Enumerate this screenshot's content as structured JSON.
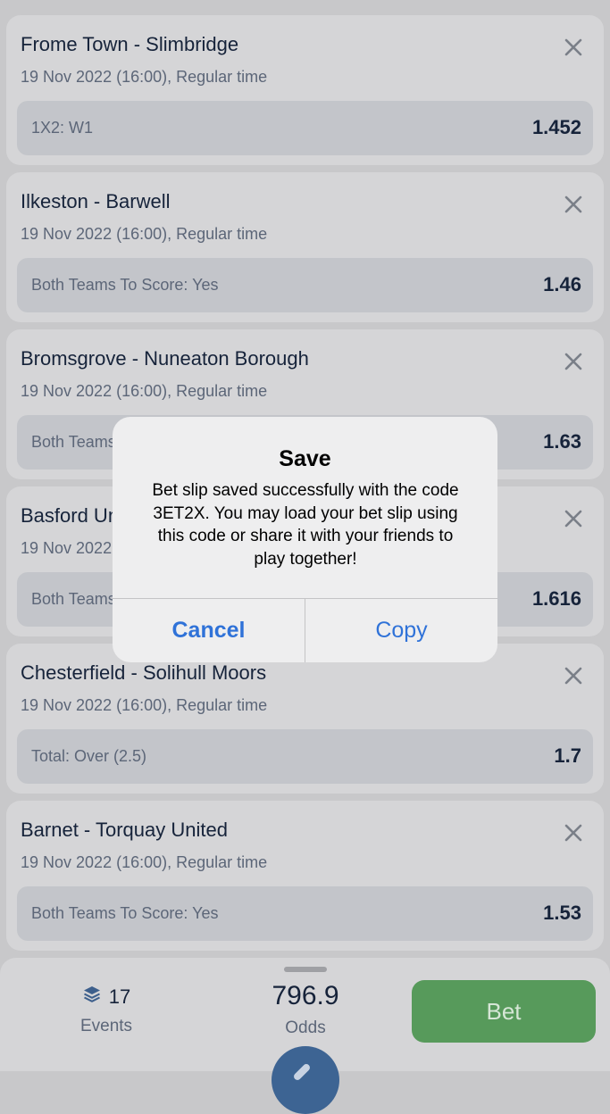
{
  "bets": [
    {
      "match": "Frome Town - Slimbridge",
      "info": "19 Nov 2022 (16:00), Regular time",
      "market": "1X2: W1",
      "odds": "1.452"
    },
    {
      "match": "Ilkeston - Barwell",
      "info": "19 Nov 2022 (16:00), Regular time",
      "market": "Both Teams To Score: Yes",
      "odds": "1.46"
    },
    {
      "match": "Bromsgrove - Nuneaton Borough",
      "info": "19 Nov 2022 (16:00), Regular time",
      "market": "Both Teams To Score: Yes",
      "odds": "1.63"
    },
    {
      "match": "Basford United",
      "info": "19 Nov 2022 (16:00), Regular time",
      "market": "Both Teams To Score: Yes",
      "odds": "1.616"
    },
    {
      "match": "Chesterfield - Solihull Moors",
      "info": "19 Nov 2022 (16:00), Regular time",
      "market": "Total: Over (2.5)",
      "odds": "1.7"
    },
    {
      "match": "Barnet - Torquay United",
      "info": "19 Nov 2022 (16:00), Regular time",
      "market": "Both Teams To Score: Yes",
      "odds": "1.53"
    }
  ],
  "footer": {
    "events_count": "17",
    "events_label": "Events",
    "total_odds": "796.9",
    "odds_label": "Odds",
    "bet_label": "Bet"
  },
  "dialog": {
    "title": "Save",
    "message": "Bet slip saved successfully with the code 3ET2X. You may load your bet slip using this code or share it with your friends to play together!",
    "cancel_label": "Cancel",
    "copy_label": "Copy"
  },
  "colors": {
    "accent": "#2f72d8",
    "bet_button": "#579a5b",
    "text_primary": "#16233a",
    "text_secondary": "#5c6678"
  },
  "icons": {
    "remove": "close-icon",
    "events": "layers-icon"
  }
}
